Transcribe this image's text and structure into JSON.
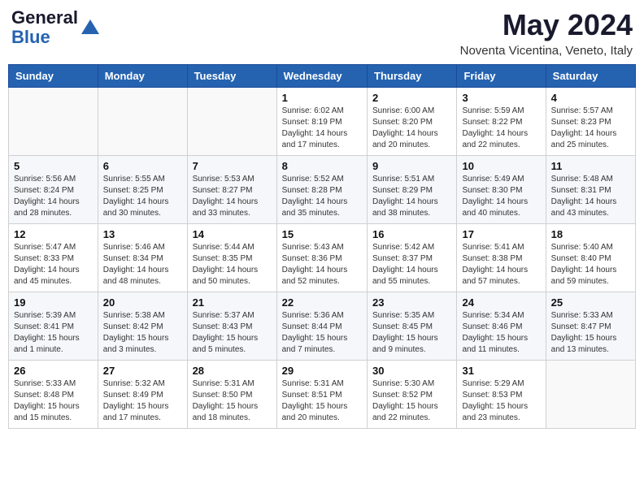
{
  "header": {
    "logo_general": "General",
    "logo_blue": "Blue",
    "month_title": "May 2024",
    "location": "Noventa Vicentina, Veneto, Italy"
  },
  "days_of_week": [
    "Sunday",
    "Monday",
    "Tuesday",
    "Wednesday",
    "Thursday",
    "Friday",
    "Saturday"
  ],
  "weeks": [
    [
      {
        "day": "",
        "info": ""
      },
      {
        "day": "",
        "info": ""
      },
      {
        "day": "",
        "info": ""
      },
      {
        "day": "1",
        "info": "Sunrise: 6:02 AM\nSunset: 8:19 PM\nDaylight: 14 hours\nand 17 minutes."
      },
      {
        "day": "2",
        "info": "Sunrise: 6:00 AM\nSunset: 8:20 PM\nDaylight: 14 hours\nand 20 minutes."
      },
      {
        "day": "3",
        "info": "Sunrise: 5:59 AM\nSunset: 8:22 PM\nDaylight: 14 hours\nand 22 minutes."
      },
      {
        "day": "4",
        "info": "Sunrise: 5:57 AM\nSunset: 8:23 PM\nDaylight: 14 hours\nand 25 minutes."
      }
    ],
    [
      {
        "day": "5",
        "info": "Sunrise: 5:56 AM\nSunset: 8:24 PM\nDaylight: 14 hours\nand 28 minutes."
      },
      {
        "day": "6",
        "info": "Sunrise: 5:55 AM\nSunset: 8:25 PM\nDaylight: 14 hours\nand 30 minutes."
      },
      {
        "day": "7",
        "info": "Sunrise: 5:53 AM\nSunset: 8:27 PM\nDaylight: 14 hours\nand 33 minutes."
      },
      {
        "day": "8",
        "info": "Sunrise: 5:52 AM\nSunset: 8:28 PM\nDaylight: 14 hours\nand 35 minutes."
      },
      {
        "day": "9",
        "info": "Sunrise: 5:51 AM\nSunset: 8:29 PM\nDaylight: 14 hours\nand 38 minutes."
      },
      {
        "day": "10",
        "info": "Sunrise: 5:49 AM\nSunset: 8:30 PM\nDaylight: 14 hours\nand 40 minutes."
      },
      {
        "day": "11",
        "info": "Sunrise: 5:48 AM\nSunset: 8:31 PM\nDaylight: 14 hours\nand 43 minutes."
      }
    ],
    [
      {
        "day": "12",
        "info": "Sunrise: 5:47 AM\nSunset: 8:33 PM\nDaylight: 14 hours\nand 45 minutes."
      },
      {
        "day": "13",
        "info": "Sunrise: 5:46 AM\nSunset: 8:34 PM\nDaylight: 14 hours\nand 48 minutes."
      },
      {
        "day": "14",
        "info": "Sunrise: 5:44 AM\nSunset: 8:35 PM\nDaylight: 14 hours\nand 50 minutes."
      },
      {
        "day": "15",
        "info": "Sunrise: 5:43 AM\nSunset: 8:36 PM\nDaylight: 14 hours\nand 52 minutes."
      },
      {
        "day": "16",
        "info": "Sunrise: 5:42 AM\nSunset: 8:37 PM\nDaylight: 14 hours\nand 55 minutes."
      },
      {
        "day": "17",
        "info": "Sunrise: 5:41 AM\nSunset: 8:38 PM\nDaylight: 14 hours\nand 57 minutes."
      },
      {
        "day": "18",
        "info": "Sunrise: 5:40 AM\nSunset: 8:40 PM\nDaylight: 14 hours\nand 59 minutes."
      }
    ],
    [
      {
        "day": "19",
        "info": "Sunrise: 5:39 AM\nSunset: 8:41 PM\nDaylight: 15 hours\nand 1 minute."
      },
      {
        "day": "20",
        "info": "Sunrise: 5:38 AM\nSunset: 8:42 PM\nDaylight: 15 hours\nand 3 minutes."
      },
      {
        "day": "21",
        "info": "Sunrise: 5:37 AM\nSunset: 8:43 PM\nDaylight: 15 hours\nand 5 minutes."
      },
      {
        "day": "22",
        "info": "Sunrise: 5:36 AM\nSunset: 8:44 PM\nDaylight: 15 hours\nand 7 minutes."
      },
      {
        "day": "23",
        "info": "Sunrise: 5:35 AM\nSunset: 8:45 PM\nDaylight: 15 hours\nand 9 minutes."
      },
      {
        "day": "24",
        "info": "Sunrise: 5:34 AM\nSunset: 8:46 PM\nDaylight: 15 hours\nand 11 minutes."
      },
      {
        "day": "25",
        "info": "Sunrise: 5:33 AM\nSunset: 8:47 PM\nDaylight: 15 hours\nand 13 minutes."
      }
    ],
    [
      {
        "day": "26",
        "info": "Sunrise: 5:33 AM\nSunset: 8:48 PM\nDaylight: 15 hours\nand 15 minutes."
      },
      {
        "day": "27",
        "info": "Sunrise: 5:32 AM\nSunset: 8:49 PM\nDaylight: 15 hours\nand 17 minutes."
      },
      {
        "day": "28",
        "info": "Sunrise: 5:31 AM\nSunset: 8:50 PM\nDaylight: 15 hours\nand 18 minutes."
      },
      {
        "day": "29",
        "info": "Sunrise: 5:31 AM\nSunset: 8:51 PM\nDaylight: 15 hours\nand 20 minutes."
      },
      {
        "day": "30",
        "info": "Sunrise: 5:30 AM\nSunset: 8:52 PM\nDaylight: 15 hours\nand 22 minutes."
      },
      {
        "day": "31",
        "info": "Sunrise: 5:29 AM\nSunset: 8:53 PM\nDaylight: 15 hours\nand 23 minutes."
      },
      {
        "day": "",
        "info": ""
      }
    ]
  ]
}
